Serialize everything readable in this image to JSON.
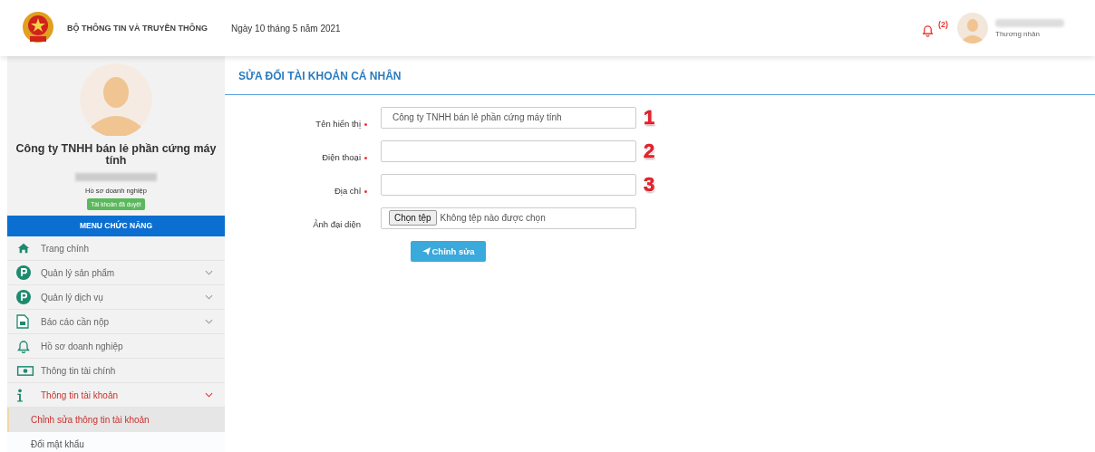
{
  "header": {
    "ministry": "BỘ THÔNG TIN VÀ TRUYỀN THÔNG",
    "date": "Ngày 10 tháng 5 năm 2021",
    "notification_count": "(2)",
    "user_role": "Thương nhân"
  },
  "sidebar": {
    "company_name": "Công ty TNHH bán lẻ phần cứng máy tính",
    "profile_label": "Hồ sơ doanh nghiệp",
    "status_badge": "Tài khoản đã duyệt",
    "menu_title": "MENU CHỨC NĂNG",
    "items": [
      {
        "label": "Trang chính",
        "kind": "home",
        "selected": false
      },
      {
        "label": "Quản lý sản phẩm",
        "kind": "p-circle",
        "selected": false,
        "expanded": false
      },
      {
        "label": "Quản lý dịch vụ",
        "kind": "p-circle",
        "selected": false,
        "expanded": false
      },
      {
        "label": "Báo cáo cần nộp",
        "kind": "document",
        "selected": false,
        "expanded": false
      },
      {
        "label": "Hồ sơ doanh nghiệp",
        "kind": "bell",
        "selected": false
      },
      {
        "label": "Thông tin tài chính",
        "kind": "money",
        "selected": false
      },
      {
        "label": "Thông tin tài khoản",
        "kind": "info",
        "selected": true,
        "expanded": true,
        "children": [
          {
            "label": "Chỉnh sửa thông tin tài khoản",
            "selected": true
          },
          {
            "label": "Đổi mật khẩu",
            "selected": false
          }
        ]
      }
    ]
  },
  "main": {
    "title": "SỬA ĐỔI TÀI KHOẢN CÁ NHÂN",
    "fields": [
      {
        "kind": "text",
        "label": "Tên hiển thị",
        "required": true,
        "value": "Công ty TNHH bán lẻ phần cứng máy tính",
        "marker": "1"
      },
      {
        "kind": "text",
        "label": "Điện thoại",
        "required": true,
        "marker": "2"
      },
      {
        "kind": "text",
        "label": "Địa chỉ",
        "required": true,
        "marker": "3"
      },
      {
        "kind": "file",
        "label": "Ảnh đại diện",
        "required": false,
        "button": "Chọn tệp",
        "file_status": "Không tệp nào được chọn"
      }
    ],
    "submit": "Chỉnh sửa"
  }
}
